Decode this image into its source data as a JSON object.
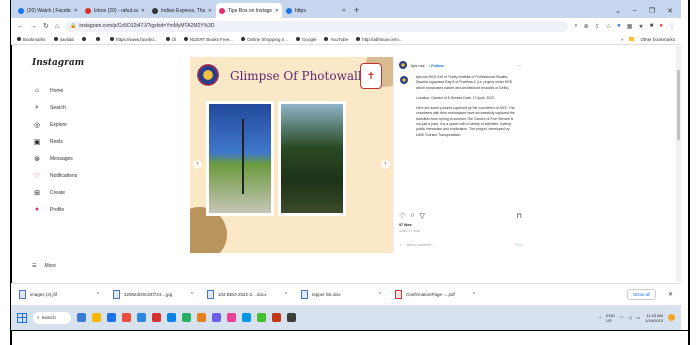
{
  "browser": {
    "tabs": [
      {
        "label": "(20) Watch | Facebook",
        "color": "#1877f2",
        "active": false
      },
      {
        "label": "Inbox (20) - rahul.rahtmud",
        "color": "#d93025",
        "active": false
      },
      {
        "label": "Indian Express, Thu 19 Jan",
        "color": "#333333",
        "active": false
      },
      {
        "label": "Tips Ros on Instagram: \"NSS",
        "color": "#e1306c",
        "active": true
      },
      {
        "label": "https",
        "color": "#1a73e8",
        "active": false
      }
    ],
    "new_tab": "+",
    "window_controls": [
      "⌄",
      "–",
      "❐",
      "✕"
    ],
    "url": "instagram.com/p/Co5O12t4TJ/?igshid=YmMyMTA2M2Y%3D",
    "bookmarks": [
      "Bookmarks",
      "navitab",
      "",
      "",
      "https://www.facebo...",
      "cll",
      "NCERT Books Free...",
      "Online Shopping n...",
      "Google",
      "YouTube",
      "http://abhinav.onm..."
    ],
    "other_bookmarks": "Other bookmarks"
  },
  "instagram": {
    "logo": "Instagram",
    "nav": [
      {
        "label": "Home",
        "icon": "⌂",
        "name": "home"
      },
      {
        "label": "Search",
        "icon": "⌕",
        "name": "search"
      },
      {
        "label": "Explore",
        "icon": "◎",
        "name": "explore"
      },
      {
        "label": "Reels",
        "icon": "▣",
        "name": "reels"
      },
      {
        "label": "Messages",
        "icon": "⊛",
        "name": "messages"
      },
      {
        "label": "Notifications",
        "icon": "♡",
        "name": "notifications"
      },
      {
        "label": "Create",
        "icon": "⊞",
        "name": "create"
      },
      {
        "label": "Profile",
        "icon": "●",
        "name": "profile"
      }
    ],
    "more": "More",
    "post": {
      "title": "Glimpse Of Photowalk",
      "username": "tips.nss",
      "follow": "• Follow",
      "caption": [
        "tips.nss NSS Cell of Trinity Institute of Professional Studies, Dwarka organised Day 8 of Prarthna-2 (i.e. project under NSS which showcases nature and architecture beauties of Delhi).",
        "Location: Garden of 5 Senses Date: 17 April, 2022",
        "Here are some pictures captured by the volunteers of NSS. The volunteers with their enthusiasm have successfully captured the transition from spring to summer.The Garden of Five Senses is not just a park, it is a space with a variety of activities, inviting public interaction and exploration. The project, developed by Delhi Tourism Transportation"
      ],
      "likes": "97 likes",
      "date": "APRIL 17, 2022",
      "add_comment": "Add a comment...",
      "post_btn": "Post"
    }
  },
  "downloads": [
    {
      "name": "images (3).jfif",
      "type": "img"
    },
    {
      "name": "329823f40c04f724....jpg",
      "type": "img"
    },
    {
      "name": "103 BDO-2022-2....docx",
      "type": "doc"
    },
    {
      "name": "topper list.xlsx",
      "type": "xls"
    },
    {
      "name": "ConfirmationPage-....pdf",
      "type": "pdf"
    }
  ],
  "show_all": "Show all",
  "taskbar": {
    "search": "Search",
    "apps": [
      "#3a7bd5",
      "#f5b700",
      "#1a73e8",
      "#e74c3c",
      "#2e86de",
      "#d63031",
      "#0984e3",
      "#27ae60",
      "#e67e22",
      "#6c5ce7",
      "#e84393",
      "#0097e6",
      "#44bd32",
      "#c23616",
      "#3d3d3d"
    ],
    "lang": "ENG\nUS",
    "time": "11:23 AM",
    "date": "1/19/2023"
  }
}
